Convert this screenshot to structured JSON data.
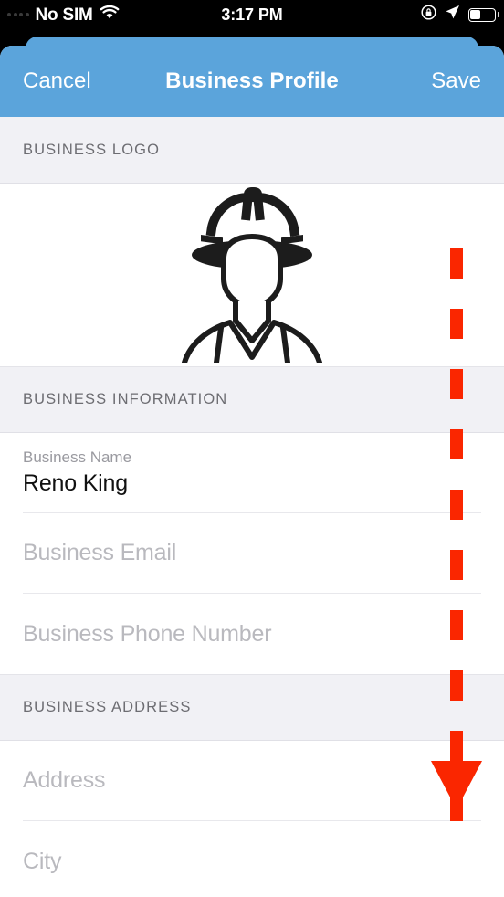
{
  "status_bar": {
    "signal_icon": "signal-dots-icon",
    "carrier": "No SIM",
    "wifi_icon": "wifi-icon",
    "time": "3:17 PM",
    "rotation_lock_icon": "rotation-lock-icon",
    "location_icon": "location-arrow-icon",
    "battery_icon": "battery-icon"
  },
  "navbar": {
    "cancel_label": "Cancel",
    "title": "Business Profile",
    "save_label": "Save",
    "background_color": "#5ba4db"
  },
  "sections": [
    {
      "header": "BUSINESS LOGO",
      "logo_icon": "construction-worker-icon"
    },
    {
      "header": "BUSINESS INFORMATION",
      "fields": [
        {
          "label": "Business Name",
          "value": "Reno King",
          "placeholder": "Business Name"
        },
        {
          "label": "",
          "value": "",
          "placeholder": "Business Email"
        },
        {
          "label": "",
          "value": "",
          "placeholder": "Business Phone Number"
        }
      ]
    },
    {
      "header": "BUSINESS ADDRESS",
      "fields": [
        {
          "label": "",
          "value": "",
          "placeholder": "Address"
        },
        {
          "label": "",
          "value": "",
          "placeholder": "City"
        }
      ]
    }
  ],
  "annotation": {
    "type": "scroll-down-arrow",
    "color": "#fa2600",
    "dash_count": 10,
    "direction": "down"
  }
}
